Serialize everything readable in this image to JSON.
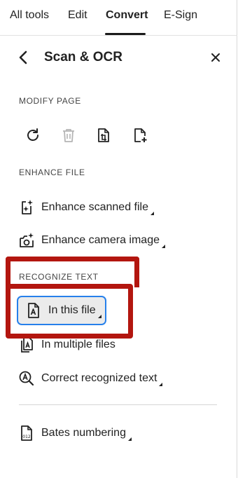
{
  "tabs": [
    {
      "label": "All tools"
    },
    {
      "label": "Edit"
    },
    {
      "label": "Convert"
    },
    {
      "label": "E-Sign"
    }
  ],
  "active_tab": "Convert",
  "panel": {
    "title": "Scan & OCR"
  },
  "sections": {
    "modify_page": {
      "heading": "MODIFY PAGE",
      "icons": [
        "rotate-icon",
        "delete-icon",
        "crop-page-icon",
        "insert-page-icon"
      ]
    },
    "enhance_file": {
      "heading": "ENHANCE FILE",
      "items": [
        {
          "label": "Enhance scanned file",
          "icon": "enhance-scanned-icon"
        },
        {
          "label": "Enhance camera image",
          "icon": "enhance-camera-icon"
        }
      ]
    },
    "recognize_text": {
      "heading": "RECOGNIZE TEXT",
      "items": [
        {
          "label": "In this file",
          "icon": "text-file-icon",
          "selected": true
        },
        {
          "label": "In multiple files",
          "icon": "multiple-files-icon"
        },
        {
          "label": "Correct recognized text",
          "icon": "correct-text-icon"
        }
      ]
    },
    "other": {
      "items": [
        {
          "label": "Bates numbering",
          "icon": "bates-numbering-icon"
        }
      ]
    }
  },
  "colors": {
    "selection_border": "#2680eb",
    "annotation": "#b3160f",
    "selected_bg": "#ebebeb"
  }
}
